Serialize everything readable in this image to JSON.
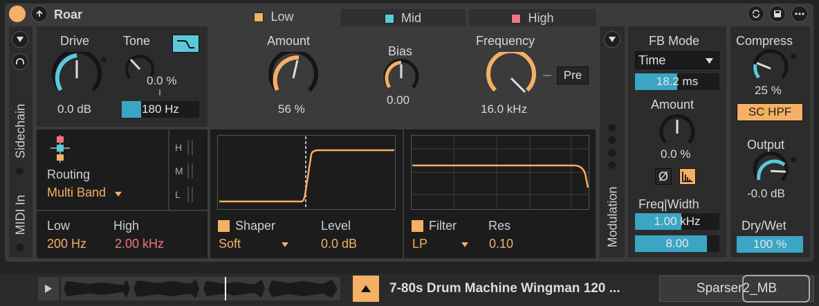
{
  "device": {
    "title": "Roar",
    "tabs": [
      {
        "label": "Low",
        "color": "#f4b064"
      },
      {
        "label": "Mid",
        "color": "#5bc8dc"
      },
      {
        "label": "High",
        "color": "#f07484"
      }
    ]
  },
  "sidechain": {
    "label": "Sidechain",
    "midi_label": "MIDI In"
  },
  "drive": {
    "label": "Drive",
    "value": "0.0 dB"
  },
  "tone": {
    "label": "Tone",
    "value": "0.0 %",
    "freq": "180 Hz",
    "freq_fill": 0.25
  },
  "amount": {
    "label": "Amount",
    "value": "56 %"
  },
  "bias": {
    "label": "Bias",
    "value": "0.00"
  },
  "frequency": {
    "label": "Frequency",
    "value": "16.0 kHz",
    "pre_label": "Pre"
  },
  "routing": {
    "label": "Routing",
    "value": "Multi Band",
    "meters": [
      "H",
      "M",
      "L"
    ]
  },
  "crossover": {
    "low_label": "Low",
    "low_value": "200 Hz",
    "high_label": "High",
    "high_value": "2.00 kHz"
  },
  "shaper": {
    "label": "Shaper",
    "type": "Soft",
    "level_label": "Level",
    "level_value": "0.0 dB"
  },
  "filter": {
    "label": "Filter",
    "type": "LP",
    "res_label": "Res",
    "res_value": "0.10"
  },
  "modulation": {
    "label": "Modulation"
  },
  "feedback": {
    "mode_label": "FB Mode",
    "mode_value": "Time",
    "time_value": "18.2 ms",
    "time_fill": 0.5,
    "amount_label": "Amount",
    "amount_value": "0.0 %",
    "phase_label": "Ø",
    "freq_width_label": "Freq|Width",
    "freq_value": "1.00 kHz",
    "freq_fill": 0.55,
    "width_value": "8.00",
    "width_fill": 0.85
  },
  "output": {
    "compress_label": "Compress",
    "compress_value": "25 %",
    "sc_hpf_label": "SC HPF",
    "output_label": "Output",
    "output_value": "-0.0 dB",
    "drywet_label": "Dry/Wet",
    "drywet_value": "100 %"
  },
  "bottom_bar": {
    "clip_name": "7-80s Drum Machine Wingman 120 ...",
    "preset_name": "Sparser2_MB"
  }
}
